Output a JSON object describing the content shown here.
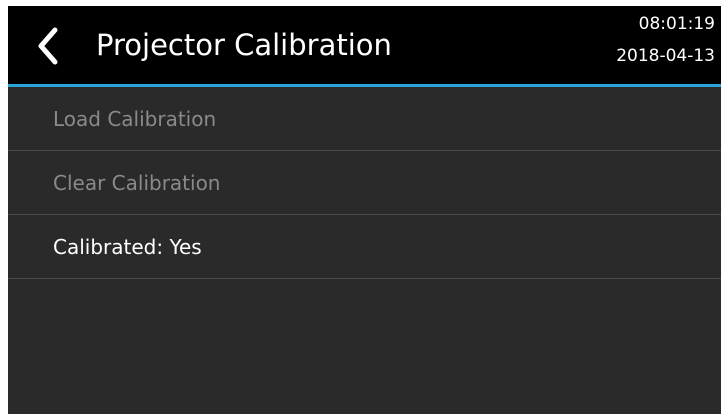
{
  "header": {
    "title": "Projector Calibration",
    "back_icon": "chevron-left-icon",
    "time": "08:01:19",
    "date": "2018-04-13"
  },
  "colors": {
    "header_bg": "#000000",
    "accent": "#2aa3d8",
    "body_bg": "#2a2a2a",
    "disabled_text": "#8a8a8a",
    "enabled_text": "#ffffff"
  },
  "menu": {
    "items": [
      {
        "label": "Load Calibration",
        "state": "disabled"
      },
      {
        "label": "Clear Calibration",
        "state": "disabled"
      },
      {
        "label": "Calibrated: Yes",
        "state": "enabled"
      }
    ]
  }
}
